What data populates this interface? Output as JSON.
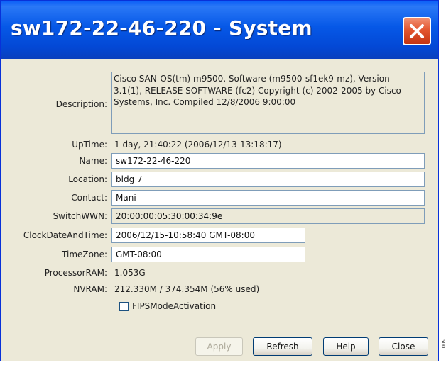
{
  "window": {
    "title": "sw172-22-46-220 - System"
  },
  "description": {
    "label": "Description:",
    "lines": [
      "Cisco SAN-OS(tm) m9500, Software (m9500-sf1ek9-mz), Version",
      "3.1(1), RELEASE SOFTWARE (fc2) Copyright (c) 2002-2005 by Cisco",
      "Systems, Inc. Compiled 12/8/2006 9:00:00"
    ]
  },
  "uptime": {
    "label": "UpTime:",
    "value": "1 day, 21:40:22 (2006/12/13-13:18:17)"
  },
  "name": {
    "label": "Name:",
    "value": "sw172-22-46-220"
  },
  "location": {
    "label": "Location:",
    "value": "bldg 7"
  },
  "contact": {
    "label": "Contact:",
    "value": "Mani"
  },
  "switchwwn": {
    "label": "SwitchWWN:",
    "value": "20:00:00:05:30:00:34:9e"
  },
  "clock": {
    "label": "ClockDateAndTime:",
    "value": "2006/12/15-10:58:40 GMT-08:00"
  },
  "timezone": {
    "label": "TimeZone:",
    "value": "GMT-08:00"
  },
  "processor_ram": {
    "label": "ProcessorRAM:",
    "value": "1.053G"
  },
  "nvram": {
    "label": "NVRAM:",
    "value": "212.330M / 374.354M (56% used)"
  },
  "fips": {
    "label": "FIPSModeActivation",
    "checked": false
  },
  "buttons": {
    "apply": "Apply",
    "refresh": "Refresh",
    "help": "Help",
    "close": "Close"
  },
  "edge_text": "500"
}
